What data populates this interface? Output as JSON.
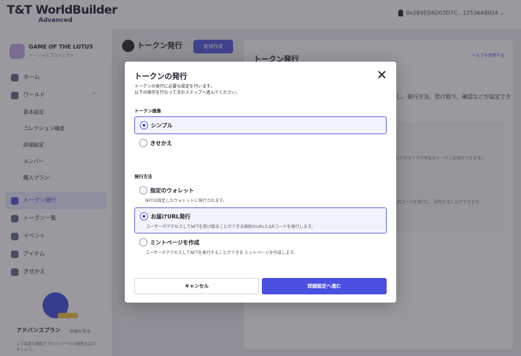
{
  "app": {
    "brand": "T&T WorldBuilder",
    "brand_sub": "Advanced",
    "account": "0x2B9ED6D03D7C...12536AB024"
  },
  "sidebar": {
    "project_name": "GAME OF THE LOTUS",
    "project_sub": "ソーシャルプロジェクト",
    "items": [
      {
        "label": "ホーム",
        "icon": "home-icon"
      },
      {
        "label": "ワールド",
        "icon": "globe-icon"
      },
      {
        "label": "基本設定",
        "icon": ""
      },
      {
        "label": "コレクション構成",
        "icon": ""
      },
      {
        "label": "詳細設定",
        "icon": ""
      },
      {
        "label": "メンバー",
        "icon": ""
      },
      {
        "label": "購入プラン",
        "icon": ""
      },
      {
        "label": "トークン発行",
        "icon": "token-icon"
      },
      {
        "label": "トークン一覧",
        "icon": "list-icon"
      },
      {
        "label": "イベント",
        "icon": "event-icon"
      },
      {
        "label": "アイテム",
        "icon": "item-icon"
      },
      {
        "label": "きせかえ",
        "icon": "dressup-icon"
      }
    ],
    "promo_title": "アドバンスプラン",
    "promo_link": "詳細を見る",
    "promo_text": "より高度な機能でプロジェクトの可能性を広げましょう。"
  },
  "content": {
    "header": "トークン発行",
    "new_button": "新規作成",
    "panel_title": "トークン発行",
    "panel_help": "ヘルプを参照する",
    "panel_text": "し、発行方法、受け取り、確認などが設定でき",
    "panel_line1": "カスタマイズが可能なトークンを発行できます。",
    "panel_line2": "QRコードを発行し、配布することができます。"
  },
  "modal": {
    "title": "トークンの発行",
    "desc_line1": "トークンの発行に必要な設定を行います。",
    "desc_line2": "以下の操作を行なって次のステップへ進んでください。",
    "image_section_label": "トークン画像",
    "image_options": [
      {
        "label": "シンプル",
        "selected": true
      },
      {
        "label": "きせかえ",
        "selected": false
      }
    ],
    "method_section_label": "発行方法",
    "method_options": [
      {
        "label": "指定のウォレット",
        "help": "NFTは指定したウォレットに発行されます。",
        "selected": false
      },
      {
        "label": "お届けURL発行",
        "help": "ユーザーがアクセスしてNFTを受け取ることができる個別のURLとQRコードを発行します。",
        "selected": true
      },
      {
        "label": "ミントページを作成",
        "help": "ユーザーがアクセスしてNFTを発行することができる ミントページを作成します。",
        "selected": false
      }
    ],
    "cancel_label": "キャンセル",
    "next_label": "詳細設定へ進む"
  },
  "colors": {
    "accent": "#4a4fe0",
    "selected_bg": "#f3f3fe"
  }
}
